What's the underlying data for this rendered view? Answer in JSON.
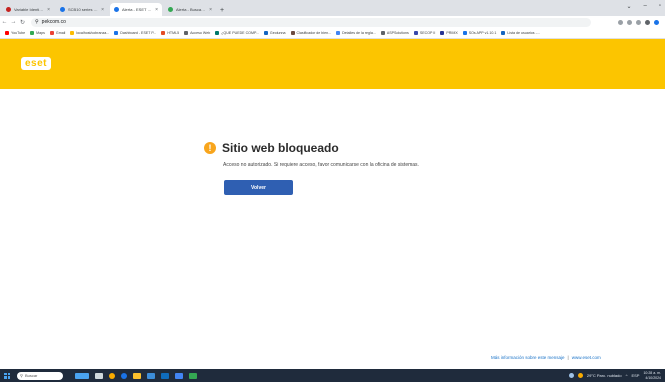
{
  "browser": {
    "tabs": [
      {
        "title": "Variable Identicación Manut - In",
        "color": "#c5221f",
        "active": false
      },
      {
        "title": "SCB10 series Full Driver & Softw",
        "color": "#1a73e8",
        "active": false
      },
      {
        "title": "Alerta - ESET Endpoint Security",
        "color": "#1a73e8",
        "active": true
      },
      {
        "title": "Alerta - Buscar con Google",
        "color": "#34a853",
        "active": false
      }
    ],
    "url": "pekcom.co"
  },
  "bookmarks": [
    {
      "label": "YouTube",
      "color": "#ff0000"
    },
    {
      "label": "Maps",
      "color": "#34a853"
    },
    {
      "label": "Gmail",
      "color": "#ea4335"
    },
    {
      "label": "localhost/cobranza...",
      "color": "#fbbc04"
    },
    {
      "label": "Dashboard - ESET P...",
      "color": "#1a73e8"
    },
    {
      "label": "HTML5",
      "color": "#e34c26"
    },
    {
      "label": "Acceso Web",
      "color": "#5f6368"
    },
    {
      "label": "¿QUE PUEDE COMP...",
      "color": "#00796b"
    },
    {
      "label": "Geolunna",
      "color": "#1565c0"
    },
    {
      "label": "Clasificador de bien...",
      "color": "#6d4c41"
    },
    {
      "label": "Detalles de la regla...",
      "color": "#4285f4"
    },
    {
      "label": "ASPSolutions",
      "color": "#5f6368"
    },
    {
      "label": "SECOP II",
      "color": "#3949ab"
    },
    {
      "label": "PRIMX",
      "color": "#283593"
    },
    {
      "label": "SOs APP v1.10.1",
      "color": "#1a73e8"
    },
    {
      "label": "Lista de usuarios -...",
      "color": "#1565c0"
    }
  ],
  "eset": {
    "logo_text": "eset",
    "alert_title": "Sitio web bloqueado",
    "alert_message": "Acceso no autorizado. Si requiere acceso, favor comunicarse con la oficina de sistemas.",
    "back_button": "Volver",
    "footer_more_info": "Más información sobre este mensaje",
    "footer_separator": "|",
    "footer_site": "www.eset.com"
  },
  "taskbar": {
    "search_placeholder": "Buscar",
    "weather": "29°C  Parc. nublado",
    "language": "ESP",
    "time": "10:28 a. m.",
    "date": "4/10/2024",
    "apps": [
      "#4aa3f0",
      "#f9ab00",
      "#1a73e8",
      "#34a853",
      "#ea4335",
      "#1a73e8",
      "#0f9d58",
      "#4285f4"
    ]
  },
  "colors": {
    "eset_yellow": "#fcc500",
    "button_blue": "#2f5fb2",
    "warning_orange": "#f8a51c"
  }
}
